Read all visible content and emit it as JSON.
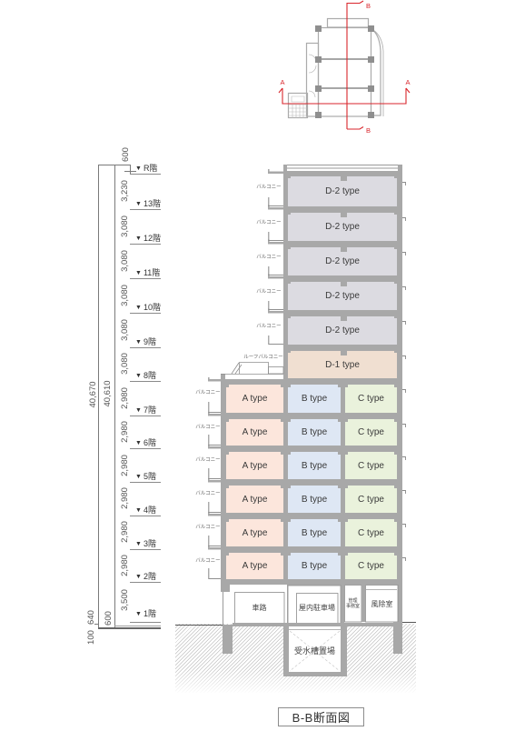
{
  "key_plan": {
    "section_a_label_left": "A",
    "section_a_label_right": "A",
    "section_b_label_top": "B",
    "section_b_label_bottom": "B",
    "section_line_color": "#d9262c"
  },
  "level_marker": "▼",
  "levels": [
    "R階",
    "13階",
    "12階",
    "11階",
    "10階",
    "9階",
    "8階",
    "7階",
    "6階",
    "5階",
    "4階",
    "3階",
    "2階",
    "1階"
  ],
  "dimensions": {
    "overall_outer": "40,670",
    "overall_inner": "40,610",
    "parapet": "600",
    "floor_heights": [
      "3,230",
      "3,080",
      "3,080",
      "3,080",
      "3,080",
      "3,080",
      "2,980",
      "2,980",
      "2,980",
      "2,980",
      "2,980",
      "2,980",
      "3,500"
    ],
    "ground_offset_outer": "640",
    "ground_offset_inner": "600",
    "below_ground": "100"
  },
  "unit_types": {
    "A": {
      "label": "A type",
      "color": "#fce6dc"
    },
    "B": {
      "label": "B type",
      "color": "#dee7f4"
    },
    "C": {
      "label": "C type",
      "color": "#eaf2dc"
    },
    "D1": {
      "label": "D-1 type",
      "color": "#f0dfd1"
    },
    "D2": {
      "label": "D-2 type",
      "color": "#dcdbe1"
    }
  },
  "floors": [
    {
      "level": "13階",
      "units": [
        {
          "type": "D2",
          "label": "D-2 type"
        }
      ]
    },
    {
      "level": "12階",
      "units": [
        {
          "type": "D2",
          "label": "D-2 type"
        }
      ]
    },
    {
      "level": "11階",
      "units": [
        {
          "type": "D2",
          "label": "D-2 type"
        }
      ]
    },
    {
      "level": "10階",
      "units": [
        {
          "type": "D2",
          "label": "D-2 type"
        }
      ]
    },
    {
      "level": "9階",
      "units": [
        {
          "type": "D2",
          "label": "D-2 type"
        }
      ]
    },
    {
      "level": "8階",
      "units": [
        {
          "type": "D1",
          "label": "D-1 type"
        }
      ]
    },
    {
      "level": "7階",
      "units": [
        {
          "type": "A",
          "label": "A type"
        },
        {
          "type": "B",
          "label": "B type"
        },
        {
          "type": "C",
          "label": "C type"
        }
      ]
    },
    {
      "level": "6階",
      "units": [
        {
          "type": "A",
          "label": "A type"
        },
        {
          "type": "B",
          "label": "B type"
        },
        {
          "type": "C",
          "label": "C type"
        }
      ]
    },
    {
      "level": "5階",
      "units": [
        {
          "type": "A",
          "label": "A type"
        },
        {
          "type": "B",
          "label": "B type"
        },
        {
          "type": "C",
          "label": "C type"
        }
      ]
    },
    {
      "level": "4階",
      "units": [
        {
          "type": "A",
          "label": "A type"
        },
        {
          "type": "B",
          "label": "B type"
        },
        {
          "type": "C",
          "label": "C type"
        }
      ]
    },
    {
      "level": "3階",
      "units": [
        {
          "type": "A",
          "label": "A type"
        },
        {
          "type": "B",
          "label": "B type"
        },
        {
          "type": "C",
          "label": "C type"
        }
      ]
    },
    {
      "level": "2階",
      "units": [
        {
          "type": "A",
          "label": "A type"
        },
        {
          "type": "B",
          "label": "B type"
        },
        {
          "type": "C",
          "label": "C type"
        }
      ]
    }
  ],
  "labels": {
    "balcony": "バルコニー",
    "roof_balcony": "ルーフバルコニー"
  },
  "ground_floor": {
    "driveway": "車路",
    "indoor_parking": "屋内駐車場",
    "management_office": {
      "line1": "管理",
      "line2": "事務室"
    },
    "windbreak_room": "風除室"
  },
  "basement": {
    "water_tank_room": "受水槽置場"
  },
  "caption": "B-B断面図"
}
